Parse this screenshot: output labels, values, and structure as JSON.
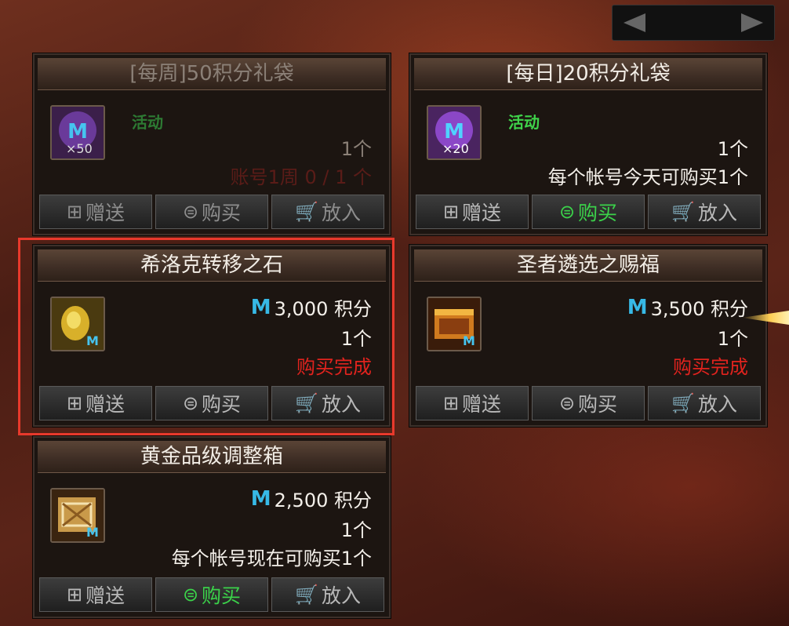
{
  "pager": {
    "prev_icon": "triangle-left-icon",
    "next_icon": "triangle-right-icon"
  },
  "buttons": {
    "gift": "赠送",
    "buy": "购买",
    "cart": "放入"
  },
  "cards": [
    {
      "title": "[每周]50积分礼袋",
      "tag": "活动",
      "icon_qty": "×50",
      "qty": "1个",
      "limit": "账号1周 0 / 1 个",
      "state": "dim",
      "buy_active": false
    },
    {
      "title": "[每日]20积分礼袋",
      "tag": "活动",
      "icon_qty": "×20",
      "qty": "1个",
      "limit": "每个帐号今天可购买1个",
      "state": "normal",
      "buy_active": true
    },
    {
      "title": "希洛克转移之石",
      "price_icon": "M",
      "price": "3,000 积分",
      "qty": "1个",
      "status": "购买完成",
      "state": "normal",
      "buy_active": false,
      "highlighted": true
    },
    {
      "title": "圣者遴选之赐福",
      "price_icon": "M",
      "price": "3,500 积分",
      "qty": "1个",
      "status": "购买完成",
      "state": "normal",
      "buy_active": false
    },
    {
      "title": "黄金品级调整箱",
      "price_icon": "M",
      "price": "2,500 积分",
      "qty": "1个",
      "limit": "每个帐号现在可购买1个",
      "state": "normal",
      "buy_active": true
    }
  ],
  "colors": {
    "highlight": "#e8392c",
    "active_green": "#3bd24a",
    "status_red": "#e1231e",
    "mileage_blue": "#37b9e6"
  }
}
